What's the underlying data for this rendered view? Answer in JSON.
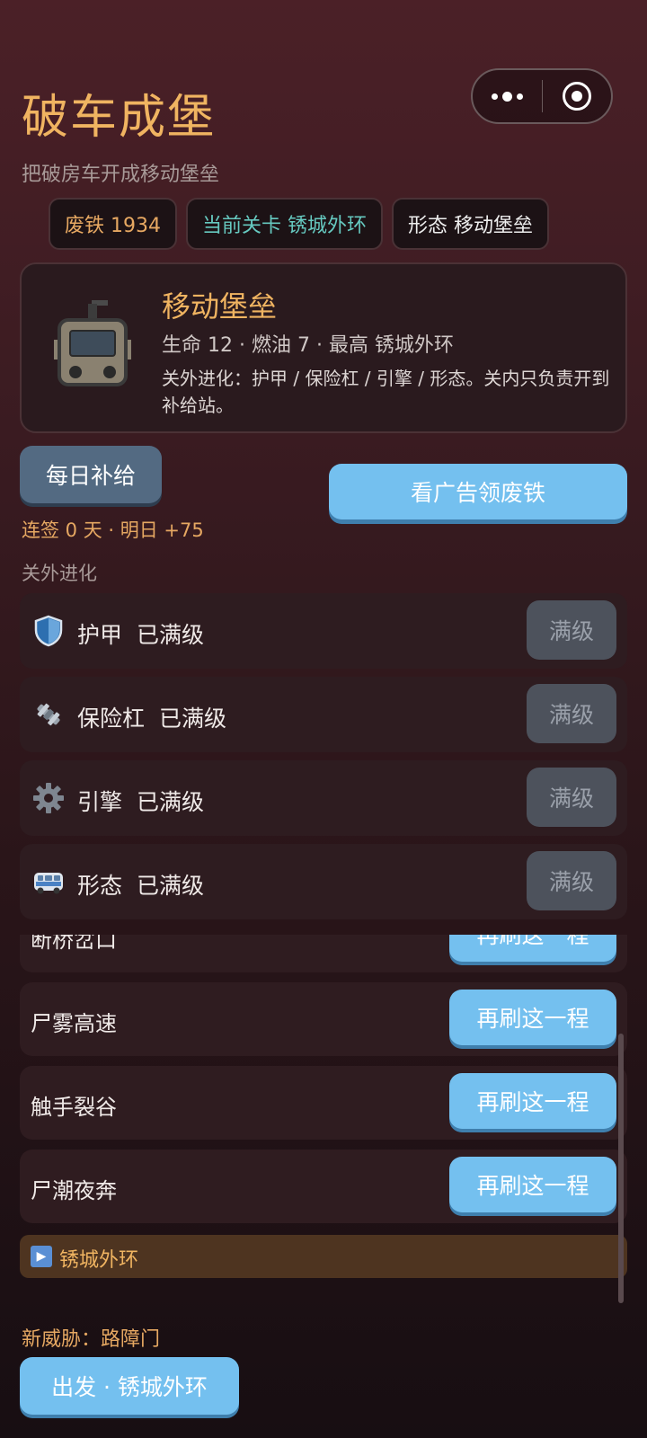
{
  "header": {
    "title": "破车成堡",
    "subtitle": "把破房车开成移动堡垒"
  },
  "capsule": {
    "more_icon": "more-dots-icon",
    "close_icon": "target-close-icon"
  },
  "chips": {
    "scrap": "废铁 1934",
    "stage": "当前关卡  锈城外环",
    "form": "形态  移动堡垒"
  },
  "profile": {
    "icon": "vehicle-robot-icon",
    "name": "移动堡垒",
    "stats": "生命 12  ·  燃油 7  ·  最高 锈城外环",
    "description": "关外进化：护甲 / 保险杠 / 引擎 / 形态。关内只负责开到补给站。"
  },
  "daily": {
    "button": "每日补给",
    "streak": "连签 0 天 · 明日 +75"
  },
  "ad_button": "看广告领废铁",
  "upgrades": {
    "section_label": "关外进化",
    "items": [
      {
        "icon": "shield-icon",
        "name": "护甲",
        "status": "已满级",
        "button": "满级"
      },
      {
        "icon": "bumper-icon",
        "name": "保险杠",
        "status": "已满级",
        "button": "满级"
      },
      {
        "icon": "gear-icon",
        "name": "引擎",
        "status": "已满级",
        "button": "满级"
      },
      {
        "icon": "van-icon",
        "name": "形态",
        "status": "已满级",
        "button": "满级"
      }
    ]
  },
  "routes": {
    "items": [
      {
        "name": "断桥岔口",
        "button": "再刷这一程"
      },
      {
        "name": "尸雾高速",
        "button": "再刷这一程"
      },
      {
        "name": "触手裂谷",
        "button": "再刷这一程"
      },
      {
        "name": "尸潮夜奔",
        "button": "再刷这一程"
      }
    ],
    "current": {
      "icon": "play-icon",
      "name": "锈城外环"
    }
  },
  "footer": {
    "threat": "新威胁：路障门",
    "go_button": "出发 · 锈城外环"
  }
}
